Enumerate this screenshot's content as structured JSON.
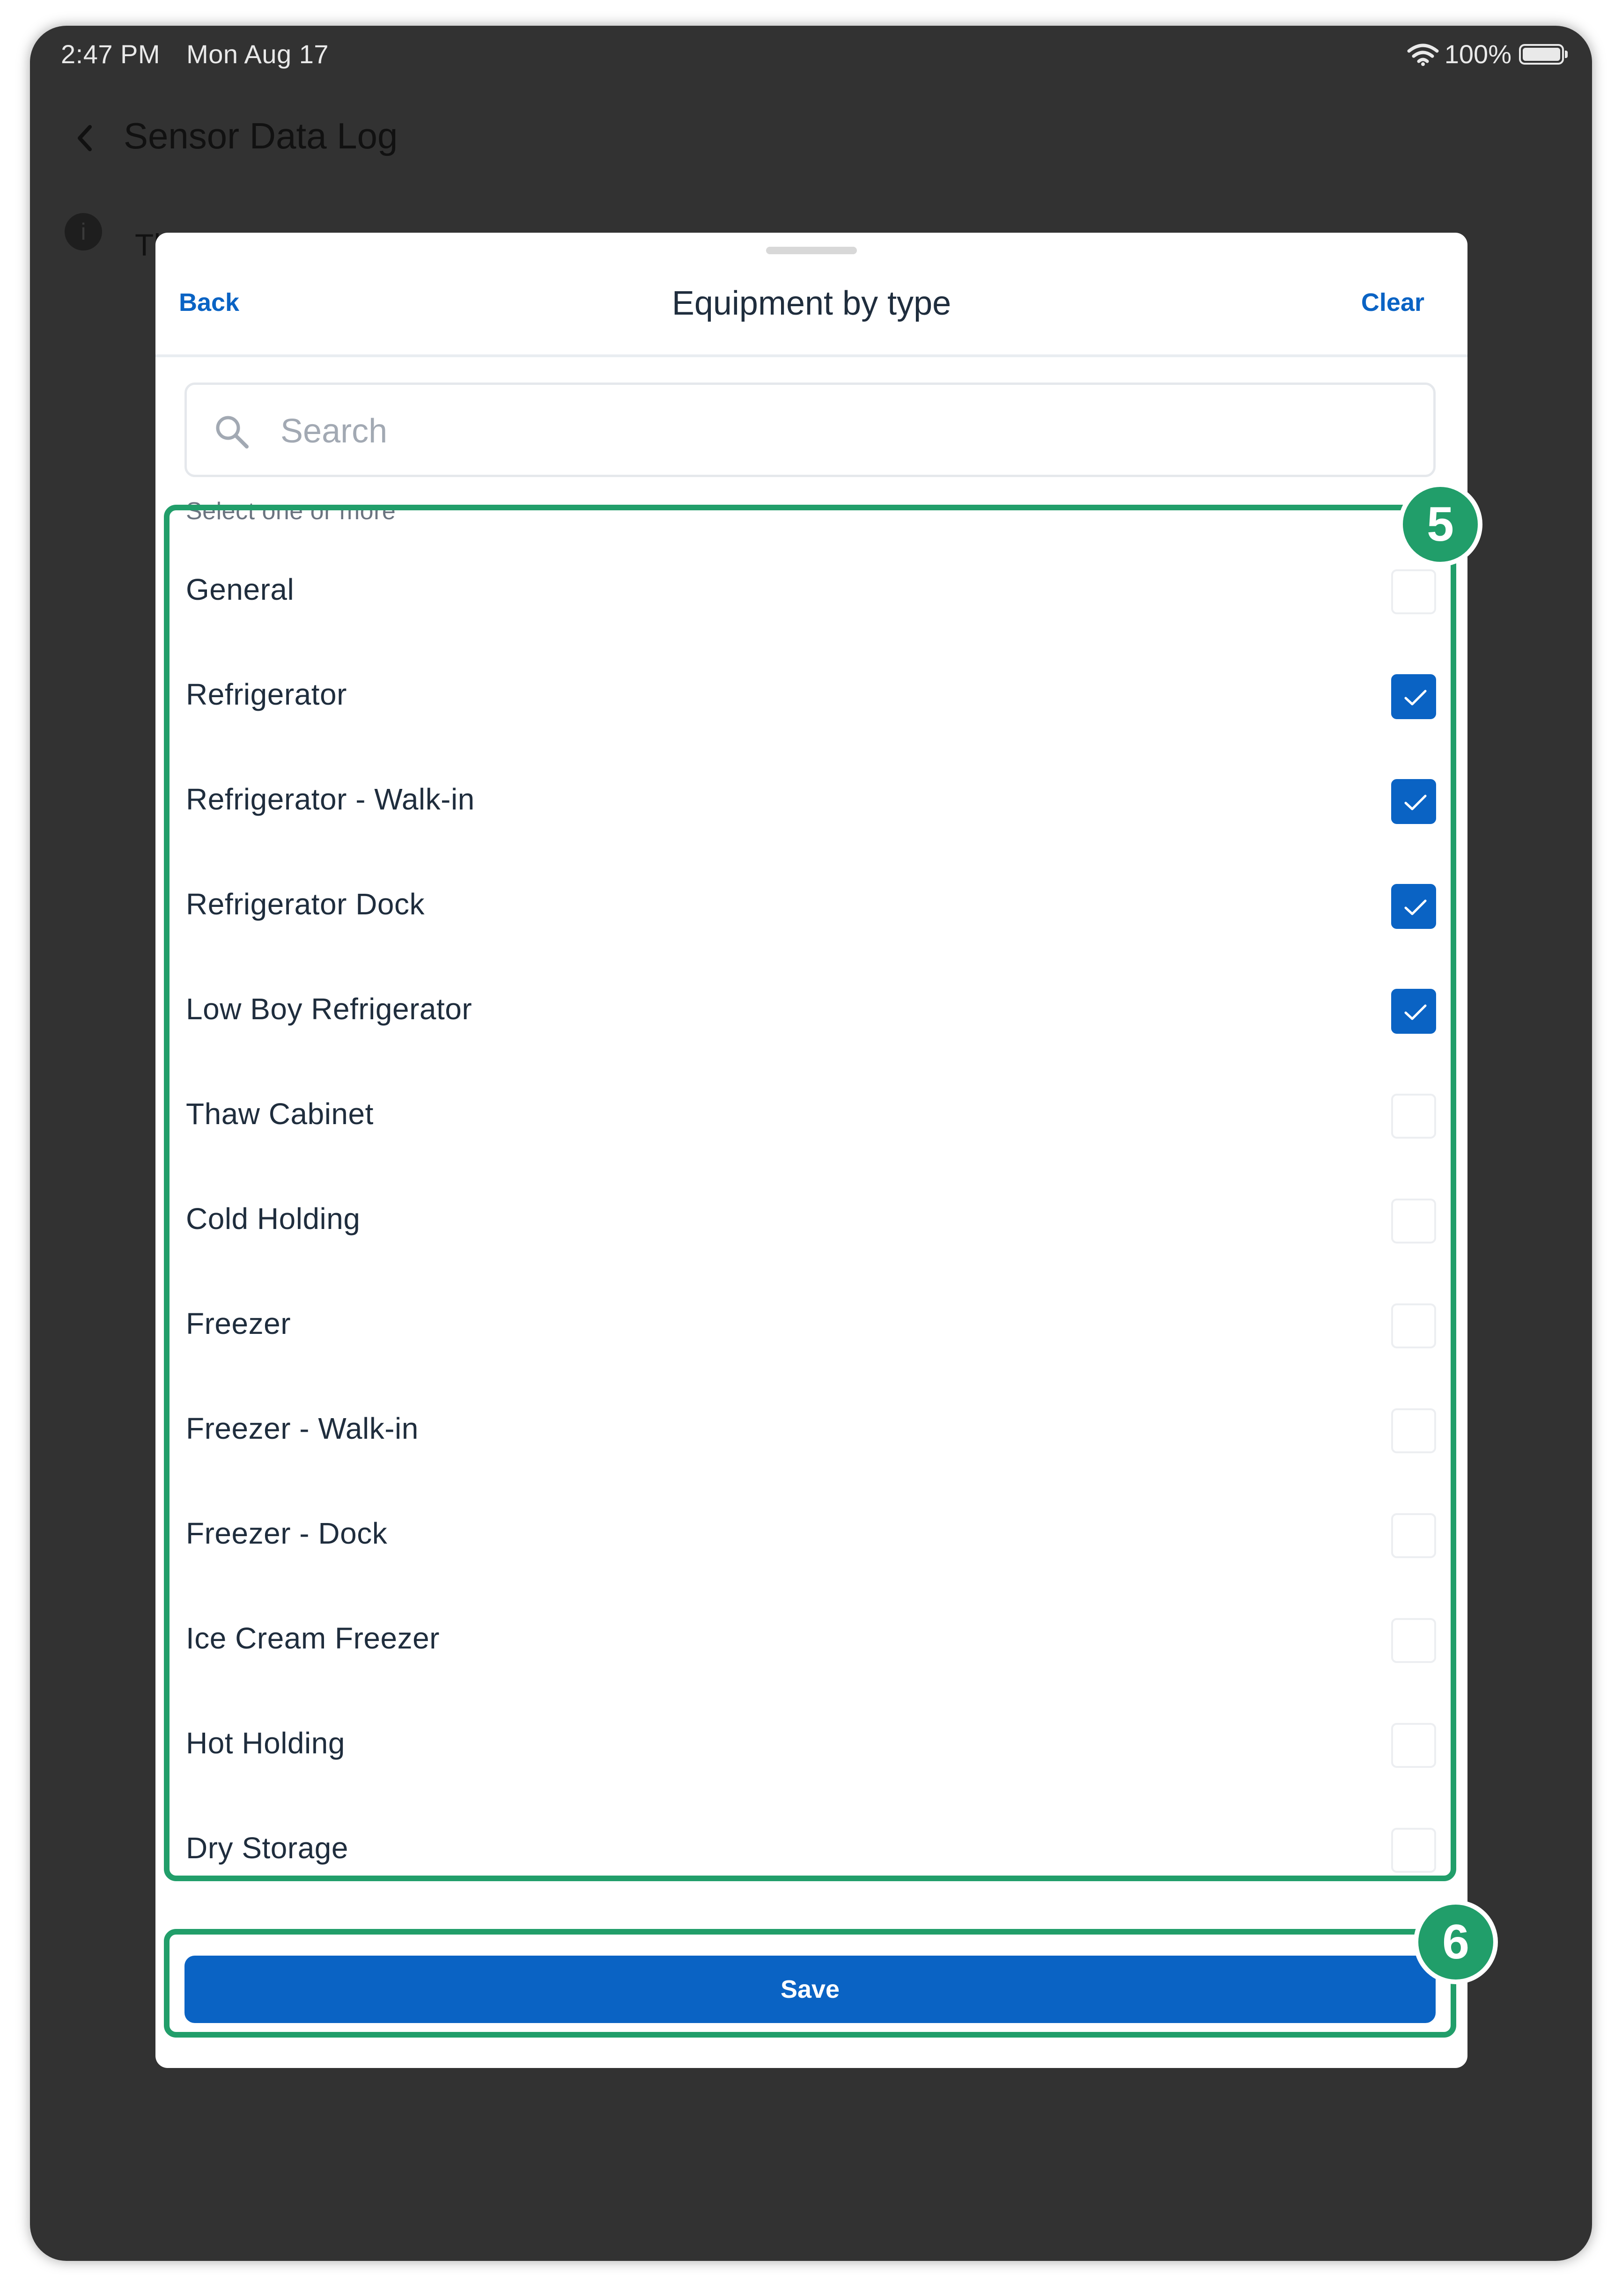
{
  "status_bar": {
    "time": "2:47 PM",
    "date": "Mon Aug 17",
    "battery_pct": "100%",
    "battery_level": 1.0
  },
  "nav": {
    "back_icon": "chevron-left-icon",
    "title": "Sensor Data Log"
  },
  "background": {
    "info_icon": "info-icon",
    "text_fragment": "Th"
  },
  "sheet": {
    "back_label": "Back",
    "title": "Equipment by type",
    "clear_label": "Clear",
    "search": {
      "placeholder": "Search",
      "value": "",
      "icon": "search-icon"
    },
    "caption": "Select one or more",
    "items": [
      {
        "label": "General",
        "checked": false
      },
      {
        "label": "Refrigerator",
        "checked": true
      },
      {
        "label": "Refrigerator - Walk-in",
        "checked": true
      },
      {
        "label": "Refrigerator Dock",
        "checked": true
      },
      {
        "label": "Low Boy Refrigerator",
        "checked": true
      },
      {
        "label": "Thaw Cabinet",
        "checked": false
      },
      {
        "label": "Cold Holding",
        "checked": false
      },
      {
        "label": "Freezer",
        "checked": false
      },
      {
        "label": "Freezer - Walk-in",
        "checked": false
      },
      {
        "label": "Freezer - Dock",
        "checked": false
      },
      {
        "label": "Ice Cream Freezer",
        "checked": false
      },
      {
        "label": "Hot Holding",
        "checked": false
      },
      {
        "label": "Dry Storage",
        "checked": false
      }
    ],
    "save_label": "Save"
  },
  "callouts": {
    "list_number": "5",
    "save_number": "6"
  },
  "colors": {
    "accent": "#0a63c4",
    "callout": "#219e6a",
    "backdrop": "#323232"
  }
}
